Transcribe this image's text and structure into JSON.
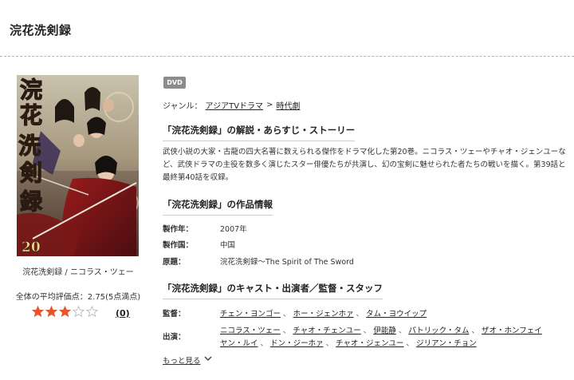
{
  "page": {
    "title": "浣花洗剣録"
  },
  "product": {
    "cover": {
      "title_glyphs": [
        "浣",
        "花",
        "洗",
        "剣",
        "録"
      ],
      "disc_number": "20"
    },
    "caption": "浣花洗剣録 / ニコラス・ツェー",
    "average_rating_text": "全体の平均評価点：2.75(5点満点)",
    "rating": 2.75,
    "rating_max": 5,
    "review_count": "(0)",
    "format_badge": "DVD"
  },
  "genre": {
    "label": "ジャンル：",
    "items": [
      "アジアTVドラマ",
      "時代劇"
    ],
    "separator": ">"
  },
  "synopsis": {
    "heading": "「浣花洗剣録」の解説・あらすじ・ストーリー",
    "text": "武侠小説の大家・古龍の四大名著に数えられる傑作をドラマ化した第20巻。ニコラス・ツェーやチャオ・ジェンユーなど、武侠ドラマの主役を数多く演じたスター俳優たちが共演し、幻の宝剣に魅せられた者たちの戦いを描く。第39話と最終第40話を収録。"
  },
  "work_info": {
    "heading": "「浣花洗剣録」の作品情報",
    "rows": [
      {
        "label": "製作年：",
        "value": "2007年"
      },
      {
        "label": "製作国：",
        "value": "中国"
      },
      {
        "label": "原題：",
        "value": "浣花洗剣録～The Spirit of The Sword"
      }
    ]
  },
  "cast": {
    "heading": "「浣花洗剣録」のキャスト・出演者／監督・スタッフ",
    "director_label": "監督：",
    "directors": [
      "チェン・ヨンゴー",
      "ホー・ジェンホァ",
      "タム・ヨウイップ"
    ],
    "cast_label": "出演：",
    "cast_line1": [
      "ニコラス・ツェー",
      "チャオ・チェンユー",
      "伊能静",
      "パトリック・タム",
      "ザオ・ホンフェイ"
    ],
    "cast_line2": [
      "ヤン・ルイ",
      "ドン・ジーホァ",
      "チャオ・ジェンユー",
      "ジリアン・チョン"
    ],
    "separator": "、",
    "more_label": "もっと見る"
  },
  "colors": {
    "star_fill": "#e8552c",
    "star_empty": "#bbbbbb",
    "badge": "#8c8c8c"
  }
}
